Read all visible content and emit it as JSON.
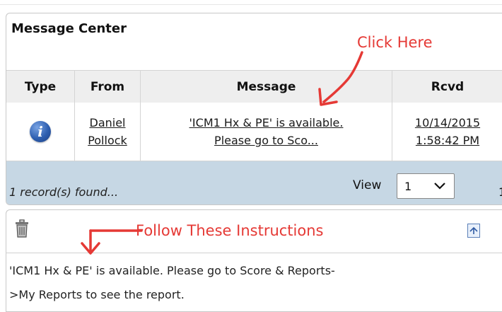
{
  "panel": {
    "title": "Message Center"
  },
  "annotations": {
    "click_here": "Click Here",
    "follow": "Follow These Instructions",
    "color": "#e53935"
  },
  "table": {
    "headers": [
      "Type",
      "From",
      "Message",
      "Rcvd"
    ],
    "rows": [
      {
        "type_icon": "info-icon",
        "from_line1": "Daniel",
        "from_line2": "Pollock",
        "message_line1": "'ICM1 Hx & PE' is available.",
        "message_line2": "Please go to Sco...",
        "rcvd_line1": "10/14/2015",
        "rcvd_line2": "1:58:42 PM"
      }
    ]
  },
  "footer": {
    "records": "1 record(s) found...",
    "view_label": "View",
    "view_value": "1",
    "page": "1"
  },
  "detail": {
    "trash_icon": "trash-icon",
    "restore_icon": "restore-icon",
    "line1": "'ICM1 Hx & PE' is available. Please go to Score & Reports-",
    "line2": ">My Reports to see the report."
  }
}
